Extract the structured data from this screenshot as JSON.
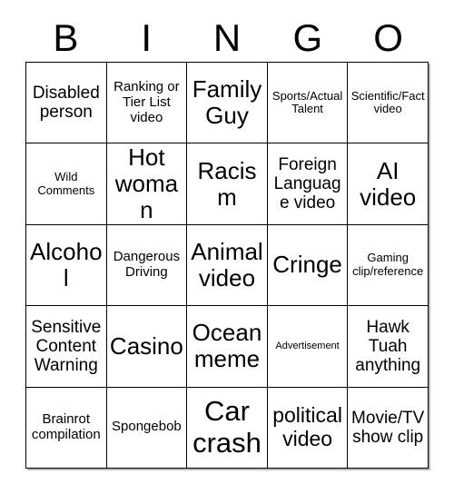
{
  "header": {
    "letters": [
      "B",
      "I",
      "N",
      "G",
      "O"
    ]
  },
  "grid": {
    "rows": [
      [
        {
          "text": "Disabled person",
          "size": "t-lg"
        },
        {
          "text": "Ranking or Tier List video",
          "size": "t-md"
        },
        {
          "text": "Family Guy",
          "size": "t-xxl"
        },
        {
          "text": "Sports/Actual Talent",
          "size": "t-sm"
        },
        {
          "text": "Scientific/Fact video",
          "size": "t-sm"
        }
      ],
      [
        {
          "text": "Wild Comments",
          "size": "t-sm"
        },
        {
          "text": "Hot woman",
          "size": "t-xxl"
        },
        {
          "text": "Racism",
          "size": "t-xxl"
        },
        {
          "text": "Foreign Language video",
          "size": "t-lg"
        },
        {
          "text": "AI video",
          "size": "t-xxl"
        }
      ],
      [
        {
          "text": "Alcohol",
          "size": "t-xxl"
        },
        {
          "text": "Dangerous Driving",
          "size": "t-md"
        },
        {
          "text": "Animal video",
          "size": "t-xxl"
        },
        {
          "text": "Cringe",
          "size": "t-xxl"
        },
        {
          "text": "Gaming clip/reference",
          "size": "t-sm"
        }
      ],
      [
        {
          "text": "Sensitive Content Warning",
          "size": "t-lg"
        },
        {
          "text": "Casino",
          "size": "t-xxl"
        },
        {
          "text": "Ocean meme",
          "size": "t-xxl"
        },
        {
          "text": "Advertisement",
          "size": "t-xs"
        },
        {
          "text": "Hawk Tuah anything",
          "size": "t-lg"
        }
      ],
      [
        {
          "text": "Brainrot compilation",
          "size": "t-md"
        },
        {
          "text": "Spongebob",
          "size": "t-md"
        },
        {
          "text": "Car crash",
          "size": "t-huge"
        },
        {
          "text": "political video",
          "size": "t-xl"
        },
        {
          "text": "Movie/TV show clip",
          "size": "t-lg"
        }
      ]
    ]
  },
  "colors": {
    "background": "#ffffff",
    "text": "#000000",
    "border": "#000000",
    "shadow": "#808080"
  }
}
